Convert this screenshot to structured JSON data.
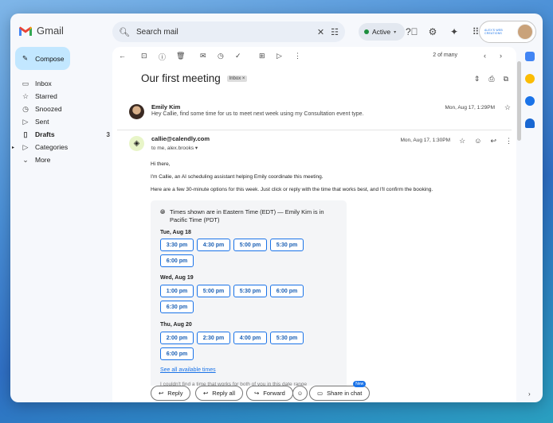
{
  "app": {
    "name": "Gmail"
  },
  "search": {
    "placeholder": "Search mail"
  },
  "status": {
    "label": "Active"
  },
  "account": {
    "brand": "ALEX'S WEB CREATIONS"
  },
  "sidebar": {
    "compose": "Compose",
    "items": [
      {
        "label": "Inbox",
        "icon": "inbox-icon",
        "count": ""
      },
      {
        "label": "Starred",
        "icon": "star-icon",
        "count": ""
      },
      {
        "label": "Snoozed",
        "icon": "clock-icon",
        "count": ""
      },
      {
        "label": "Sent",
        "icon": "send-icon",
        "count": ""
      },
      {
        "label": "Drafts",
        "icon": "draft-icon",
        "count": "3"
      },
      {
        "label": "Categories",
        "icon": "label-icon",
        "count": ""
      },
      {
        "label": "More",
        "icon": "chevron-down-icon",
        "count": ""
      }
    ]
  },
  "toolbar": {
    "pager": "2 of many"
  },
  "thread": {
    "subject": "Our first meeting",
    "tag": "Inbox ×",
    "message1": {
      "sender": "Emily Kim",
      "snippet": "Hey Callie, find some time for us to meet next week using my Consultation event type.",
      "date": "Mon, Aug 17, 1:29PM"
    },
    "message2": {
      "sender": "callie@calendly.com",
      "to": "to me, alex.brooks ▾",
      "date": "Mon, Aug 17, 1:30PM",
      "greeting": "Hi there,",
      "line1": "I'm Callie, an AI scheduling assistant helping Emily coordinate this meeting.",
      "line2": "Here are a few 30-minute options for this week. Just click or reply with the time that works best, and I'll confirm the booking."
    }
  },
  "card": {
    "timezone": "Times shown are in Eastern Time (EDT) — Emily Kim is in Pacific Time (PDT)",
    "days": [
      {
        "label": "Tue, Aug 18",
        "slots": [
          "3:30 pm",
          "4:30 pm",
          "5:00 pm",
          "5:30 pm",
          "6:00 pm"
        ]
      },
      {
        "label": "Wed, Aug 19",
        "slots": [
          "1:00 pm",
          "5:00 pm",
          "5:30 pm",
          "6:00 pm",
          "6:30 pm"
        ]
      },
      {
        "label": "Thu, Aug 20",
        "slots": [
          "2:00 pm",
          "2:30 pm",
          "4:00 pm",
          "5:30 pm",
          "6:00 pm"
        ]
      }
    ],
    "see_all": "See all available times",
    "cut_text": "I couldn't find a time that works for both of you in this date range"
  },
  "footer": {
    "reply": "Reply",
    "reply_all": "Reply all",
    "forward": "Forward",
    "share": "Share in chat",
    "new_badge": "New"
  },
  "colors": {
    "accent": "#1a73e8",
    "compose_bg": "#c2e7ff",
    "active_dot": "#1e8e3e"
  }
}
